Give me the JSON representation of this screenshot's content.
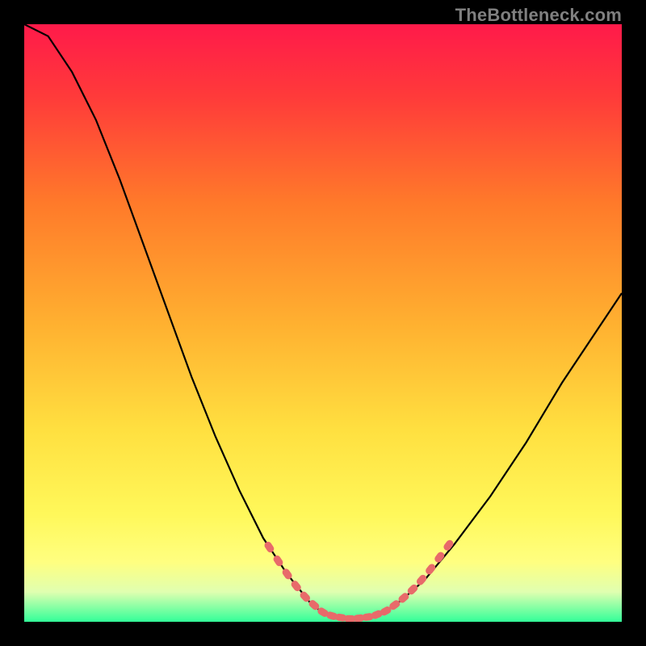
{
  "watermark": "TheBottleneck.com",
  "colors": {
    "background": "#000000",
    "gradient_top": "#ff1a4a",
    "gradient_mid": "#ffd633",
    "gradient_yellow": "#ffff66",
    "gradient_green": "#33ff99",
    "curve": "#000000",
    "marker": "#e86a6a",
    "watermark": "#808080"
  },
  "chart_data": {
    "type": "line",
    "title": "",
    "xlabel": "",
    "ylabel": "",
    "xlim": [
      0,
      100
    ],
    "ylim": [
      0,
      100
    ],
    "curve": [
      {
        "x": 0,
        "y": 100
      },
      {
        "x": 4,
        "y": 98
      },
      {
        "x": 8,
        "y": 92
      },
      {
        "x": 12,
        "y": 84
      },
      {
        "x": 16,
        "y": 74
      },
      {
        "x": 20,
        "y": 63
      },
      {
        "x": 24,
        "y": 52
      },
      {
        "x": 28,
        "y": 41
      },
      {
        "x": 32,
        "y": 31
      },
      {
        "x": 36,
        "y": 22
      },
      {
        "x": 40,
        "y": 14
      },
      {
        "x": 44,
        "y": 8
      },
      {
        "x": 48,
        "y": 3
      },
      {
        "x": 50,
        "y": 1.5
      },
      {
        "x": 52,
        "y": 0.8
      },
      {
        "x": 55,
        "y": 0.5
      },
      {
        "x": 58,
        "y": 0.8
      },
      {
        "x": 60,
        "y": 1.5
      },
      {
        "x": 63,
        "y": 3.5
      },
      {
        "x": 67,
        "y": 7
      },
      {
        "x": 72,
        "y": 13
      },
      {
        "x": 78,
        "y": 21
      },
      {
        "x": 84,
        "y": 30
      },
      {
        "x": 90,
        "y": 40
      },
      {
        "x": 96,
        "y": 49
      },
      {
        "x": 100,
        "y": 55
      }
    ],
    "markers_left": [
      {
        "x": 41,
        "y": 12.5
      },
      {
        "x": 42.5,
        "y": 10.2
      },
      {
        "x": 44,
        "y": 8
      },
      {
        "x": 45.5,
        "y": 6
      },
      {
        "x": 47,
        "y": 4.2
      },
      {
        "x": 48.5,
        "y": 2.8
      },
      {
        "x": 50,
        "y": 1.6
      },
      {
        "x": 51.5,
        "y": 1.0
      },
      {
        "x": 53,
        "y": 0.7
      },
      {
        "x": 54.5,
        "y": 0.5
      },
      {
        "x": 56,
        "y": 0.6
      },
      {
        "x": 57.5,
        "y": 0.8
      }
    ],
    "markers_right": [
      {
        "x": 59,
        "y": 1.2
      },
      {
        "x": 60.5,
        "y": 1.8
      },
      {
        "x": 62,
        "y": 2.8
      },
      {
        "x": 63.5,
        "y": 4.0
      },
      {
        "x": 65,
        "y": 5.4
      },
      {
        "x": 66.5,
        "y": 7.0
      },
      {
        "x": 68,
        "y": 8.8
      },
      {
        "x": 69.5,
        "y": 10.8
      },
      {
        "x": 71,
        "y": 12.8
      }
    ]
  }
}
